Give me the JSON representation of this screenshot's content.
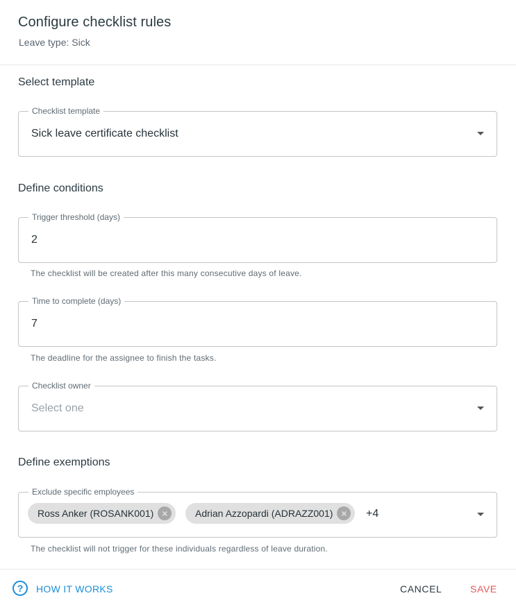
{
  "dialog": {
    "title": "Configure checklist rules",
    "subtitle": "Leave type: Sick"
  },
  "sections": {
    "template": "Select template",
    "conditions": "Define conditions",
    "exemptions": "Define exemptions"
  },
  "fields": {
    "template": {
      "label": "Checklist template",
      "value": "Sick leave certificate checklist"
    },
    "threshold": {
      "label": "Trigger threshold (days)",
      "value": "2",
      "helper": "The checklist will be created after this many consecutive days of leave."
    },
    "complete": {
      "label": "Time to complete (days)",
      "value": "7",
      "helper": "The deadline for the assignee to finish the tasks."
    },
    "owner": {
      "label": "Checklist owner",
      "placeholder": "Select one"
    },
    "exclude": {
      "label": "Exclude specific employees",
      "chips": [
        "Ross Anker (ROSANK001)",
        "Adrian Azzopardi (ADRAZZ001)"
      ],
      "more": "+4",
      "helper": "The checklist will not trigger for these individuals regardless of leave duration."
    }
  },
  "footer": {
    "help_label": "HOW IT WORKS",
    "cancel_label": "CANCEL",
    "save_label": "SAVE"
  },
  "colors": {
    "accent": "#1a8fd6",
    "save": "#e05a58",
    "chip": "#e0e0e0"
  },
  "icons": {
    "help": "question-circle-icon",
    "chip_remove": "close-circle-icon",
    "dropdown": "caret-down-icon"
  }
}
